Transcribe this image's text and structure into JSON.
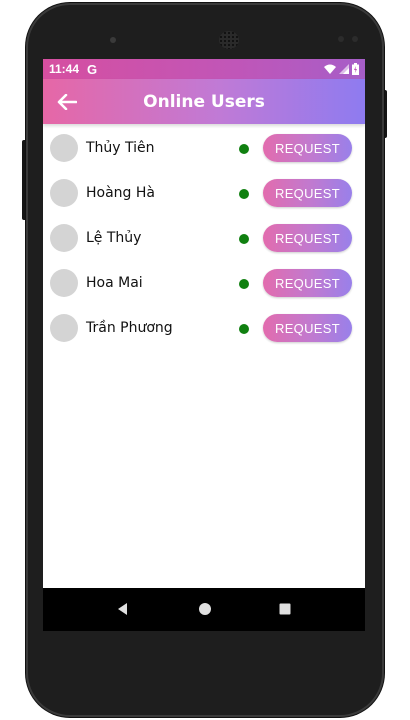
{
  "device": {
    "frame_color": "#1e1e1e"
  },
  "status_bar": {
    "time": "11:44",
    "carrier_icon": "G",
    "icons": [
      "wifi-icon",
      "signal-icon",
      "battery-icon"
    ]
  },
  "app_bar": {
    "title": "Online Users",
    "back_icon": "arrow-left-icon"
  },
  "users": [
    {
      "name": "Thủy Tiên",
      "status": "online",
      "action": "REQUEST"
    },
    {
      "name": "Hoàng Hà",
      "status": "online",
      "action": "REQUEST"
    },
    {
      "name": "Lệ Thủy",
      "status": "online",
      "action": "REQUEST"
    },
    {
      "name": "Hoa Mai",
      "status": "online",
      "action": "REQUEST"
    },
    {
      "name": "Trần Phương",
      "status": "online",
      "action": "REQUEST"
    }
  ],
  "nav_bar": {
    "buttons": [
      "back-icon",
      "home-icon",
      "recent-apps-icon"
    ]
  },
  "colors": {
    "online": "#108010",
    "gradient_start": "#e667a6",
    "gradient_end": "#8e7bf0",
    "avatar": "#d4d4d4"
  }
}
